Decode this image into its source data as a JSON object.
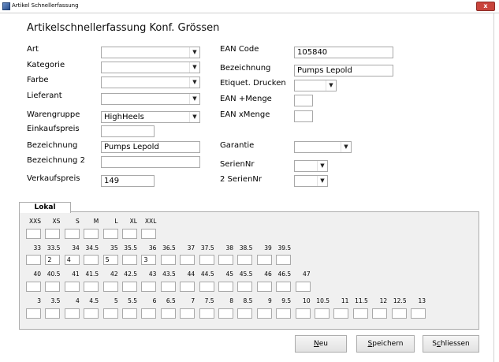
{
  "window": {
    "title": "Artikel Schnellerfassung",
    "close_label": "x"
  },
  "form": {
    "title": "Artikelschnellerfassung Konf. Grössen"
  },
  "left_fields": {
    "art": {
      "label": "Art",
      "value": ""
    },
    "kategorie": {
      "label": "Kategorie",
      "value": ""
    },
    "farbe": {
      "label": "Farbe",
      "value": ""
    },
    "lieferant": {
      "label": "Lieferant",
      "value": ""
    },
    "warengruppe": {
      "label": "Warengruppe",
      "value": "HighHeels"
    },
    "einkaufspreis": {
      "label": "Einkaufspreis",
      "value": ""
    },
    "bezeichnung": {
      "label": "Bezeichnung",
      "value": "Pumps Lepold"
    },
    "bezeichnung2": {
      "label": "Bezeichnung 2",
      "value": ""
    },
    "verkaufspreis": {
      "label": "Verkaufspreis",
      "value": "149"
    }
  },
  "right_fields": {
    "ean_code": {
      "label": "EAN Code",
      "value": "105840"
    },
    "bezeichnung": {
      "label": "Bezeichnung",
      "value": "Pumps Lepold"
    },
    "etiquet": {
      "label": "Etiquet. Drucken",
      "value": ""
    },
    "ean_plus_menge": {
      "label": "EAN +Menge",
      "value": ""
    },
    "ean_x_menge": {
      "label": "EAN xMenge",
      "value": ""
    },
    "garantie": {
      "label": "Garantie",
      "value": ""
    },
    "seriennr": {
      "label": "SerienNr",
      "value": ""
    },
    "seriennr2": {
      "label": "2 SerienNr",
      "value": ""
    }
  },
  "tabs": {
    "lokal": "Lokal"
  },
  "sizes": {
    "row1": [
      "XXS",
      "XS",
      "S",
      "M",
      "L",
      "XL",
      "XXL"
    ],
    "row1_values": [
      "",
      "",
      "",
      "",
      "",
      "",
      ""
    ],
    "row2": [
      "33",
      "33.5",
      "34",
      "34.5",
      "35",
      "35.5",
      "36",
      "36.5",
      "37",
      "37.5",
      "38",
      "38.5",
      "39",
      "39.5"
    ],
    "row2_values": [
      "",
      "2",
      "4",
      "",
      "5",
      "",
      "3",
      "",
      "",
      "",
      "",
      "",
      "",
      ""
    ],
    "row3": [
      "40",
      "40.5",
      "41",
      "41.5",
      "42",
      "42.5",
      "43",
      "43.5",
      "44",
      "44.5",
      "45",
      "45.5",
      "46",
      "46.5",
      "47"
    ],
    "row3_values": [
      "",
      "",
      "",
      "",
      "",
      "",
      "",
      "",
      "",
      "",
      "",
      "",
      "",
      "",
      ""
    ],
    "row4": [
      "3",
      "3.5",
      "4",
      "4.5",
      "5",
      "5.5",
      "6",
      "6.5",
      "7",
      "7.5",
      "8",
      "8.5",
      "9",
      "9.5",
      "10",
      "10.5",
      "11",
      "11.5",
      "12",
      "12.5",
      "13"
    ],
    "row4_values": [
      "",
      "",
      "",
      "",
      "",
      "",
      "",
      "",
      "",
      "",
      "",
      "",
      "",
      "",
      "",
      "",
      "",
      "",
      "",
      "",
      ""
    ]
  },
  "buttons": {
    "neu": {
      "mnemonic": "N",
      "rest": "eu"
    },
    "speichern": {
      "mnemonic": "S",
      "rest": "peichern"
    },
    "schliessen": {
      "pre": "S",
      "mnemonic": "c",
      "rest": "hliessen"
    }
  }
}
